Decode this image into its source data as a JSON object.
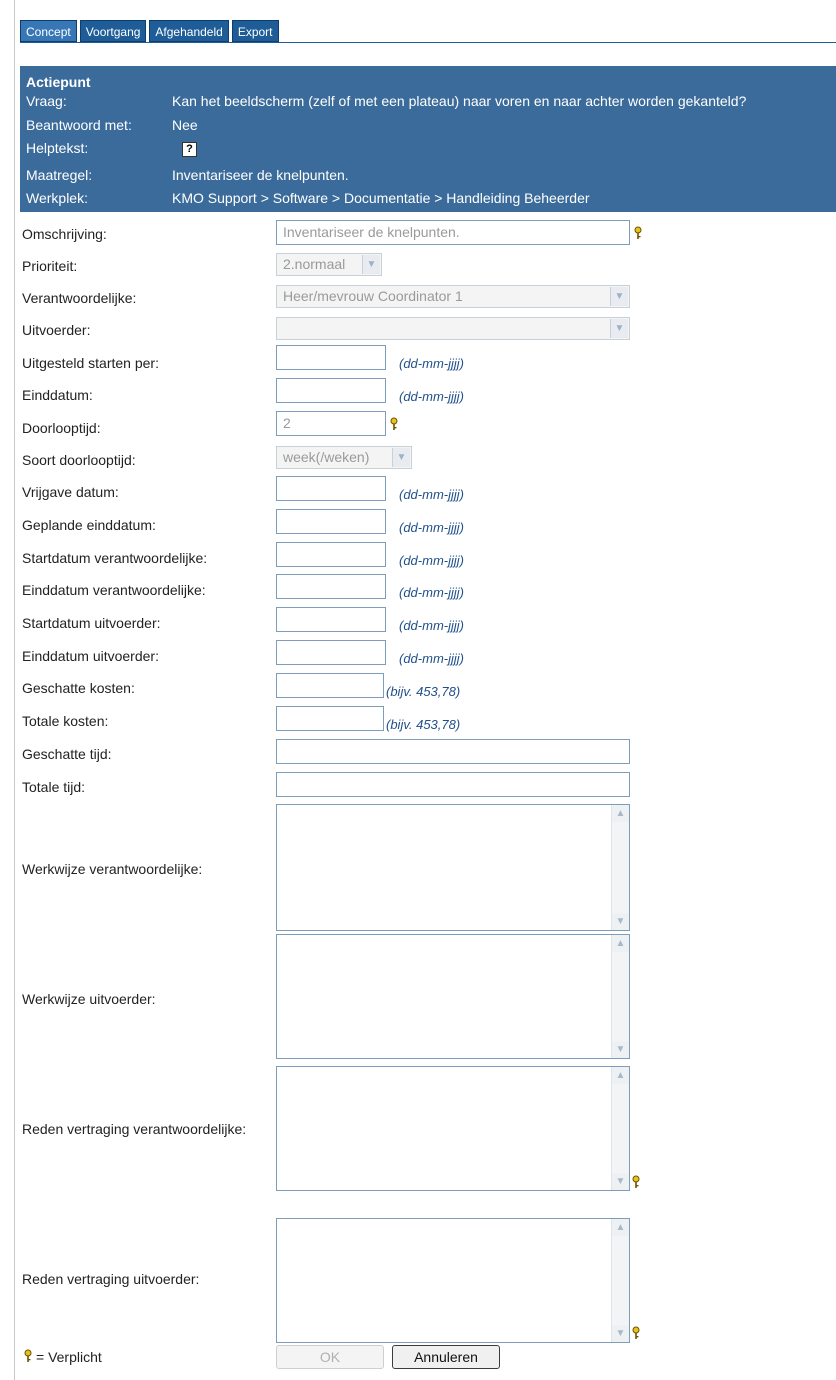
{
  "tabs": [
    {
      "label": "Concept",
      "active": true
    },
    {
      "label": "Voortgang"
    },
    {
      "label": "Afgehandeld"
    },
    {
      "label": "Export"
    }
  ],
  "info": {
    "title": "Actiepunt",
    "vraag_label": "Vraag:",
    "vraag": "Kan het beeldscherm (zelf of met een plateau) naar voren en naar achter worden gekanteld?",
    "beantwoord_label": "Beantwoord met:",
    "beantwoord": "Nee",
    "helptekst_label": "Helptekst:",
    "help_icon": "?",
    "maatregel_label": "Maatregel:",
    "maatregel": "Inventariseer de knelpunten.",
    "werkplek_label": "Werkplek:",
    "werkplek": "KMO Support > Software > Documentatie > Handleiding Beheerder"
  },
  "form": {
    "omschrijving_label": "Omschrijving:",
    "omschrijving_value": "Inventariseer de knelpunten.",
    "prioriteit_label": "Prioriteit:",
    "prioriteit_value": "2.normaal",
    "verantwoordelijke_label": "Verantwoordelijke:",
    "verantwoordelijke_value": "Heer/mevrouw Coordinator 1",
    "uitvoerder_label": "Uitvoerder:",
    "uitvoerder_value": "",
    "uitgesteld_label": "Uitgesteld starten per:",
    "einddatum_label": "Einddatum:",
    "doorlooptijd_label": "Doorlooptijd:",
    "doorlooptijd_value": "2",
    "soort_label": "Soort doorlooptijd:",
    "soort_value": "week(/weken)",
    "vrijgave_label": "Vrijgave datum:",
    "geplande_label": "Geplande einddatum:",
    "start_verantw_label": "Startdatum verantwoordelijke:",
    "eind_verantw_label": "Einddatum verantwoordelijke:",
    "start_uitv_label": "Startdatum uitvoerder:",
    "eind_uitv_label": "Einddatum uitvoerder:",
    "geschatte_kosten_label": "Geschatte kosten:",
    "totale_kosten_label": "Totale kosten:",
    "geschatte_tijd_label": "Geschatte tijd:",
    "totale_tijd_label": "Totale tijd:",
    "werkwijze_verantw_label": "Werkwijze verantwoordelijke:",
    "werkwijze_uitv_label": "Werkwijze uitvoerder:",
    "reden_verantw_label": "Reden vertraging verantwoordelijke:",
    "reden_uitv_label": "Reden vertraging uitvoerder:",
    "date_hint": "(dd-mm-jjjj)",
    "cost_hint": "(bijv. 453,78)"
  },
  "footer": {
    "legend": "= Verplicht",
    "ok_label": "OK",
    "cancel_label": "Annuleren"
  },
  "colors": {
    "tab_bg": "#1f5d99",
    "info_bg": "#3a6b9b",
    "hint": "#1f4f8a"
  },
  "icons": [
    "key-icon",
    "help-icon",
    "chevron-down-icon",
    "scroll-up-icon",
    "scroll-down-icon"
  ]
}
